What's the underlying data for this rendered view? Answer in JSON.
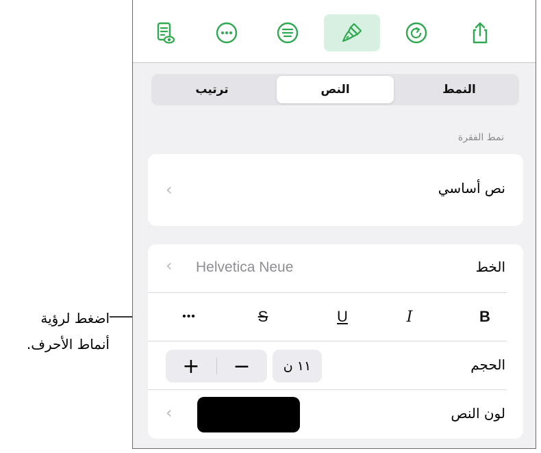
{
  "callout": {
    "line1": "اضغط لرؤية",
    "line2": "أنماط الأحرف."
  },
  "toolbar": {
    "icons": [
      "document-preview-icon",
      "more-icon",
      "list-icon",
      "paintbrush-icon",
      "redo-icon",
      "share-icon"
    ],
    "accent_color": "#2fa84f",
    "active_bg": "#d8f0e2"
  },
  "segmented": {
    "tabs": [
      "النمط",
      "النص",
      "ترتيب"
    ],
    "selected": "النص"
  },
  "paragraph_style": {
    "section_label": "نمط الفقرة",
    "value": "نص أساسي"
  },
  "font": {
    "label": "الخط",
    "value": "Helvetica Neue",
    "styles": [
      "B",
      "I",
      "U",
      "S",
      "•••"
    ]
  },
  "size": {
    "label": "الحجم",
    "value": "١١ ن",
    "plus": "+",
    "minus": "−"
  },
  "text_color": {
    "label": "لون النص",
    "swatch": "#000000"
  }
}
